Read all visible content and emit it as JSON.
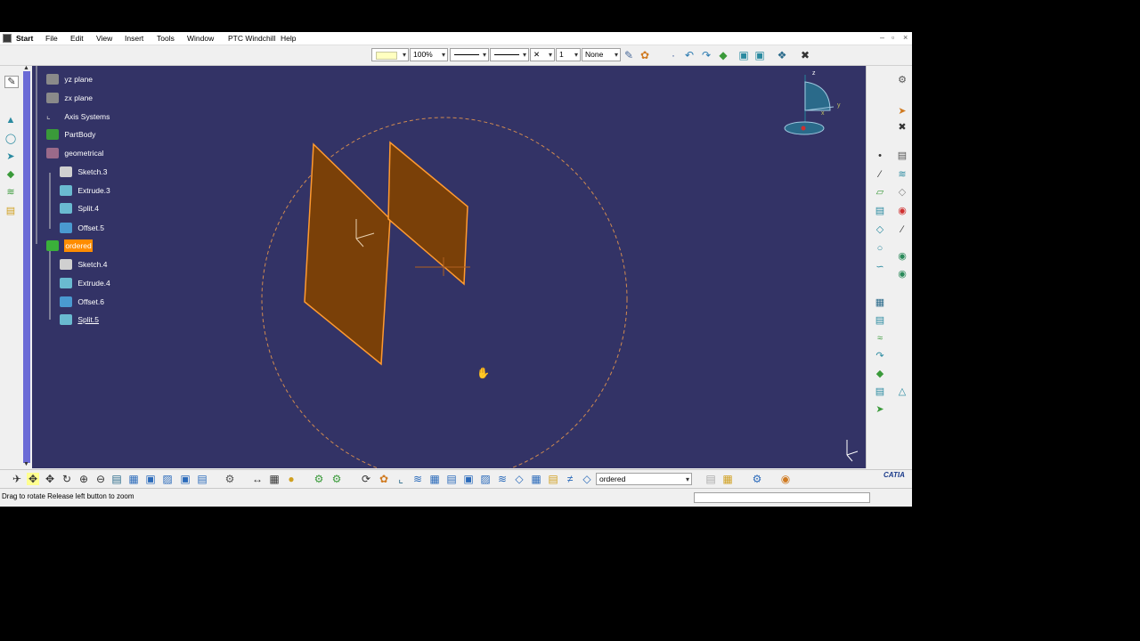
{
  "menu": {
    "items": [
      "Start",
      "File",
      "Edit",
      "View",
      "Insert",
      "Tools",
      "Window",
      "PTC Windchill",
      "Help"
    ],
    "window_controls": [
      "–",
      "▫",
      "×"
    ]
  },
  "toolbar": {
    "zoom_value": "100%",
    "layer_value": "None",
    "thickness_value": "1"
  },
  "tree": {
    "nodes": [
      {
        "label": "yz plane",
        "icon": "plane-icon"
      },
      {
        "label": "zx plane",
        "icon": "plane-icon"
      },
      {
        "label": "Axis Systems",
        "icon": "axis-systems-icon"
      },
      {
        "label": "PartBody",
        "icon": "partbody-icon"
      },
      {
        "label": "geometrical",
        "icon": "geometrical-set-icon"
      },
      {
        "label": "Sketch.3",
        "icon": "sketch-icon"
      },
      {
        "label": "Extrude.3",
        "icon": "extrude-icon"
      },
      {
        "label": "Split.4",
        "icon": "split-icon"
      },
      {
        "label": "Offset.5",
        "icon": "offset-icon"
      },
      {
        "label": "ordered",
        "icon": "ordered-set-icon",
        "selected": true
      },
      {
        "label": "Sketch.4",
        "icon": "sketch-icon"
      },
      {
        "label": "Extrude.4",
        "icon": "extrude-icon"
      },
      {
        "label": "Offset.6",
        "icon": "offset-icon"
      },
      {
        "label": "Split.5",
        "icon": "split-icon"
      }
    ]
  },
  "compass": {
    "x_label": "x",
    "y_label": "y",
    "z_label": "z"
  },
  "bottom_toolbar": {
    "current_set": "ordered"
  },
  "status": {
    "text": "Drag to rotate  Release left button to zoom"
  },
  "brand": {
    "logo_text": "CATIA"
  },
  "colors": {
    "viewport_bg": "#333366",
    "surface_fill": "#7a4008",
    "surface_edge": "#ff9a30",
    "selection_bg": "#ff8c00",
    "tree_bar": "#6b6bd6"
  }
}
